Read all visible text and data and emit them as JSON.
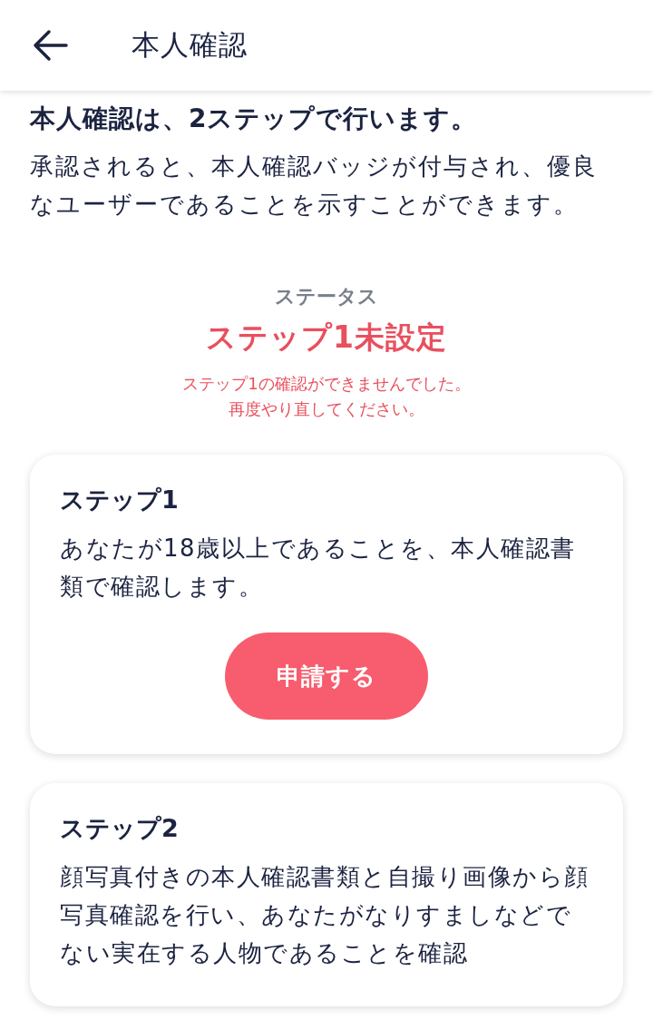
{
  "header": {
    "title": "本人確認"
  },
  "intro": {
    "heading": "本人確認は、2ステップで行います。",
    "text": "承認されると、本人確認バッジが付与され、優良なユーザーであることを示すことができます。"
  },
  "status": {
    "label": "ステータス",
    "value": "ステップ1未設定",
    "message_lines": [
      "ステップ1の確認ができませんでした。",
      "再度やり直してください。"
    ]
  },
  "steps": [
    {
      "title": "ステップ1",
      "text": "あなたが18歳以上であることを、本人確認書類で確認します。",
      "button": "申請する"
    },
    {
      "title": "ステップ2",
      "text": "顔写真付きの本人確認書類と自撮り画像から顔写真確認を行い、あなたがなりすましなどでない実在する人物であることを確認"
    }
  ]
}
